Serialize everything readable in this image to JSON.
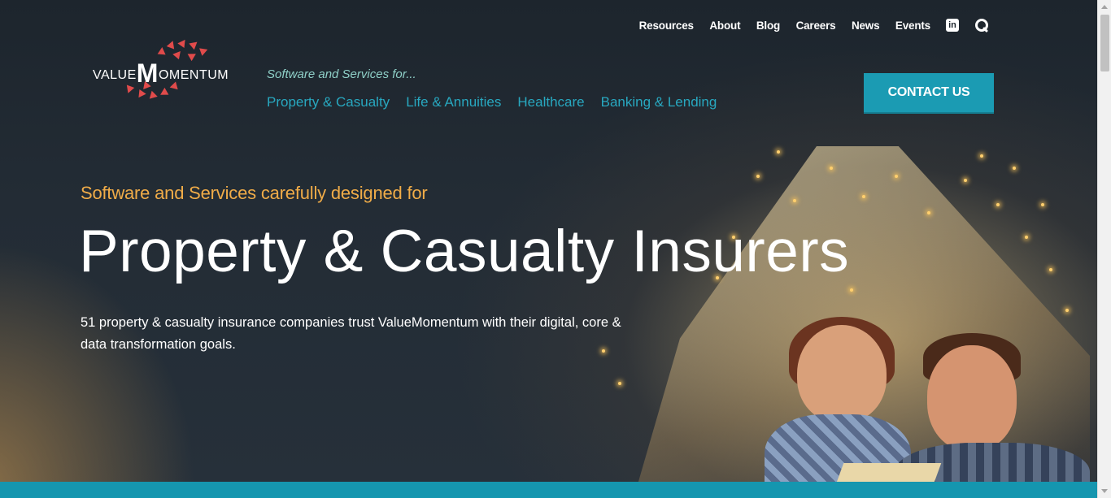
{
  "top_nav": {
    "items": [
      "Resources",
      "About",
      "Blog",
      "Careers",
      "News",
      "Events"
    ],
    "linkedin_icon": "linkedin-icon",
    "search_icon": "search-icon"
  },
  "logo": {
    "prefix": "VALUE",
    "big_letter": "M",
    "suffix": "OMENTUM",
    "accent_color": "#e04b4b"
  },
  "header": {
    "tagline": "Software and Services for...",
    "nav": [
      "Property & Casualty",
      "Life & Annuities",
      "Healthcare",
      "Banking & Lending"
    ],
    "contact_label": "CONTACT US"
  },
  "hero": {
    "kicker": "Software and Services carefully designed for",
    "title": "Property & Casualty Insurers",
    "description": "51 property & casualty insurance companies trust ValueMomentum with their digital, core & data transformation goals."
  },
  "colors": {
    "accent_teal": "#1b9bb3",
    "nav_link": "#28a8c0",
    "kicker_orange": "#f0ac48",
    "tagline_mint": "#8fd0c8"
  }
}
